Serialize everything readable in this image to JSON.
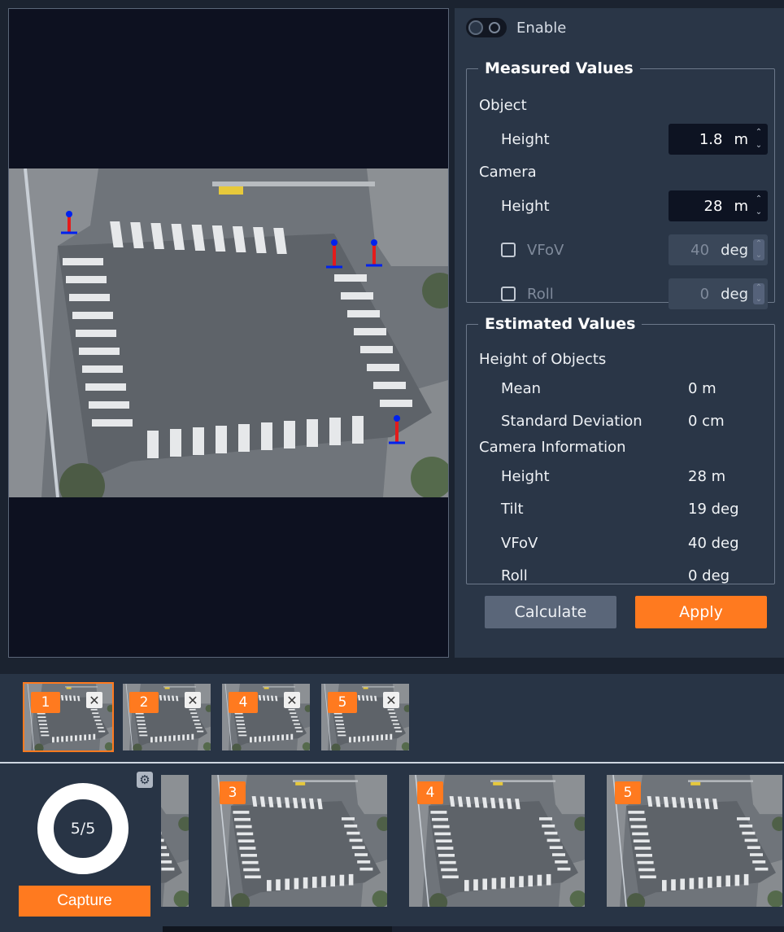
{
  "enable": {
    "label": "Enable",
    "on": false
  },
  "measured": {
    "title": "Measured Values",
    "object_label": "Object",
    "object_height": {
      "label": "Height",
      "value": "1.8",
      "unit": "m"
    },
    "camera_label": "Camera",
    "camera_height": {
      "label": "Height",
      "value": "28",
      "unit": "m"
    },
    "vfov": {
      "label": "VFoV",
      "value": "40",
      "unit": "deg",
      "checked": false
    },
    "roll": {
      "label": "Roll",
      "value": "0",
      "unit": "deg",
      "checked": false
    }
  },
  "estimated": {
    "title": "Estimated Values",
    "objects_label": "Height of Objects",
    "mean": {
      "label": "Mean",
      "value": "0 m"
    },
    "std": {
      "label": "Standard Deviation",
      "value": "0 cm"
    },
    "camera_label": "Camera Information",
    "height": {
      "label": "Height",
      "value": "28 m"
    },
    "tilt": {
      "label": "Tilt",
      "value": "19 deg"
    },
    "vfov": {
      "label": "VFoV",
      "value": "40 deg"
    },
    "roll": {
      "label": "Roll",
      "value": "0 deg"
    }
  },
  "buttons": {
    "calculate": "Calculate",
    "apply": "Apply",
    "capture": "Capture"
  },
  "captured": [
    {
      "badge": "1",
      "close": "✕",
      "selected": true
    },
    {
      "badge": "2",
      "close": "✕",
      "selected": false
    },
    {
      "badge": "4",
      "close": "✕",
      "selected": false
    },
    {
      "badge": "5",
      "close": "✕",
      "selected": false
    }
  ],
  "progress": {
    "text": "5/5",
    "current": 5,
    "total": 5
  },
  "frames": [
    {
      "badge": "3"
    },
    {
      "badge": "4"
    },
    {
      "badge": "5"
    }
  ],
  "icons": {
    "settings": "gear-icon",
    "remove": "close-icon"
  },
  "colors": {
    "accent": "#ff7a1f",
    "panel": "#2a3647",
    "marker_head": "#0022ee",
    "marker_body": "#e41b1b"
  }
}
